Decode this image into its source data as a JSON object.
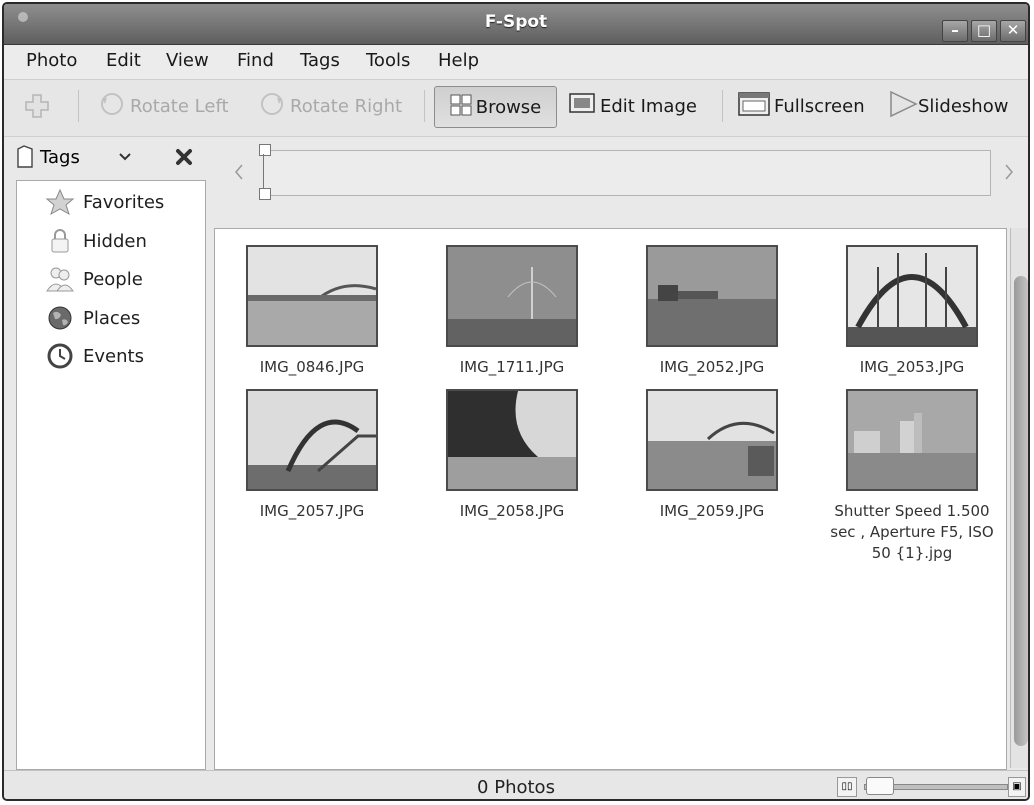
{
  "window": {
    "title": "F-Spot",
    "minimize": "–",
    "maximize": "□",
    "close": "✕"
  },
  "menu": [
    {
      "label": "Photo"
    },
    {
      "label": "Edit"
    },
    {
      "label": "View"
    },
    {
      "label": "Find"
    },
    {
      "label": "Tags"
    },
    {
      "label": "Tools"
    },
    {
      "label": "Help"
    }
  ],
  "toolbar": {
    "rotate_left": "Rotate Left",
    "rotate_right": "Rotate Right",
    "browse": "Browse",
    "edit_image": "Edit Image",
    "fullscreen": "Fullscreen",
    "slideshow": "Slideshow"
  },
  "sidebar": {
    "header": "Tags",
    "items": [
      {
        "label": "Favorites",
        "icon": "star-icon"
      },
      {
        "label": "Hidden",
        "icon": "lock-icon"
      },
      {
        "label": "People",
        "icon": "people-icon"
      },
      {
        "label": "Places",
        "icon": "globe-icon"
      },
      {
        "label": "Events",
        "icon": "clock-icon"
      }
    ]
  },
  "photos": [
    {
      "name": "IMG_0846.JPG"
    },
    {
      "name": "IMG_1711.JPG"
    },
    {
      "name": "IMG_2052.JPG"
    },
    {
      "name": "IMG_2053.JPG"
    },
    {
      "name": "IMG_2057.JPG"
    },
    {
      "name": "IMG_2058.JPG"
    },
    {
      "name": "IMG_2059.JPG"
    },
    {
      "name": "Shutter Speed 1.500 sec , Aperture F5, ISO 50 {1}.jpg"
    }
  ],
  "status": {
    "text": "0 Photos"
  }
}
